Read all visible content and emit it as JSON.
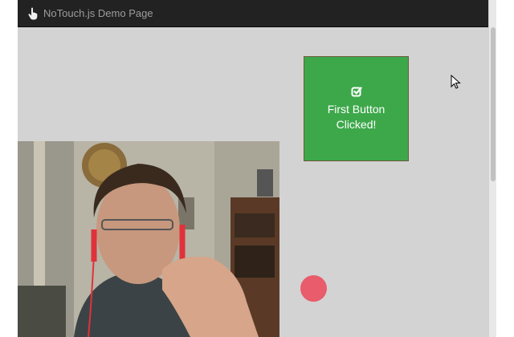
{
  "navbar": {
    "brand": "NoTouch.js Demo Page",
    "icon": "pointing-hand-icon"
  },
  "big_button": {
    "icon": "check-square-icon",
    "label": "First Button Clicked!",
    "color": "#3da84a"
  },
  "touch_indicator": {
    "color": "#e85c6b"
  },
  "webcam": {
    "description_icon": "webcam-feed"
  }
}
